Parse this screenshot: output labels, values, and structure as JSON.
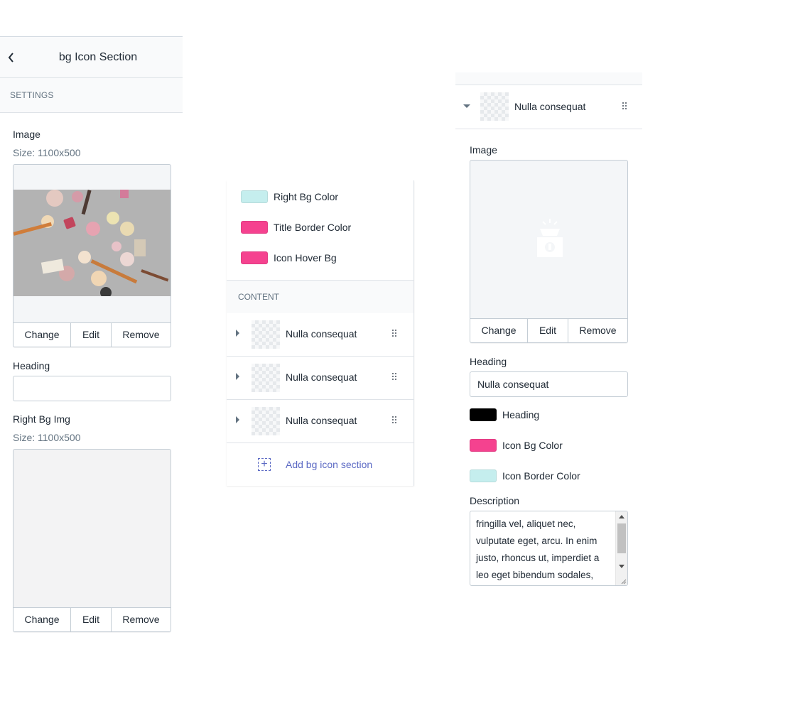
{
  "panel1": {
    "title": "bg Icon Section",
    "settings_label": "SETTINGS",
    "image": {
      "label": "Image",
      "size": "Size: 1100x500"
    },
    "buttons": {
      "change": "Change",
      "edit": "Edit",
      "remove": "Remove"
    },
    "heading": {
      "label": "Heading",
      "value": ""
    },
    "right_bg_img": {
      "label": "Right Bg Img",
      "size": "Size: 1100x500"
    }
  },
  "panel2": {
    "colors": [
      {
        "label": "Right Bg Color",
        "color": "#c5eeee"
      },
      {
        "label": "Title Border Color",
        "color": "#f5428f"
      },
      {
        "label": "Icon Hover Bg",
        "color": "#f5428f"
      }
    ],
    "content_label": "CONTENT",
    "blocks": [
      {
        "label": "Nulla consequat"
      },
      {
        "label": "Nulla consequat"
      },
      {
        "label": "Nulla consequat"
      }
    ],
    "add_label": "Add bg icon section"
  },
  "panel3": {
    "block_label": "Nulla consequat",
    "image_label": "Image",
    "buttons": {
      "change": "Change",
      "edit": "Edit",
      "remove": "Remove"
    },
    "heading_label": "Heading",
    "heading_value": "Nulla consequat",
    "colors": [
      {
        "label": "Heading",
        "color": "#000000"
      },
      {
        "label": "Icon Bg Color",
        "color": "#f5428f"
      },
      {
        "label": "Icon Border Color",
        "color": "#c5eeee"
      }
    ],
    "description_label": "Description",
    "description_value": "fringilla vel, aliquet nec,\nvulputate eget, arcu. In enim\njusto, rhoncus ut, imperdiet a\nleo eget bibendum sodales,"
  },
  "theme": {
    "accent": "#5c6ac4",
    "pink": "#f5428f",
    "aqua": "#c5eeee"
  }
}
